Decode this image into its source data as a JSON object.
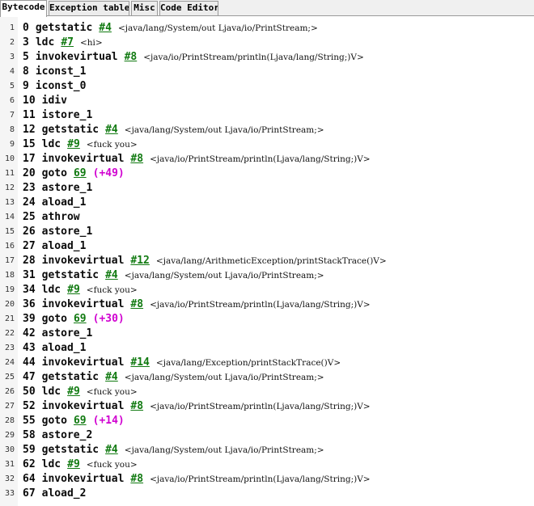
{
  "tabs": [
    {
      "label": "Bytecode",
      "active": true
    },
    {
      "label": "Exception table",
      "active": false
    },
    {
      "label": "Misc",
      "active": false
    },
    {
      "label": "Code Editor",
      "active": false
    }
  ],
  "lines": [
    {
      "n": "1",
      "off": "0",
      "op": "getstatic",
      "ref": "#4",
      "cmt": "<java/lang/System/out Ljava/io/PrintStream;>"
    },
    {
      "n": "2",
      "off": "3",
      "op": "ldc",
      "ref": "#7",
      "cmt": "<hi>"
    },
    {
      "n": "3",
      "off": "5",
      "op": "invokevirtual",
      "ref": "#8",
      "cmt": "<java/io/PrintStream/println(Ljava/lang/String;)V>"
    },
    {
      "n": "4",
      "off": "8",
      "op": "iconst_1"
    },
    {
      "n": "5",
      "off": "9",
      "op": "iconst_0"
    },
    {
      "n": "6",
      "off": "10",
      "op": "idiv"
    },
    {
      "n": "7",
      "off": "11",
      "op": "istore_1"
    },
    {
      "n": "8",
      "off": "12",
      "op": "getstatic",
      "ref": "#4",
      "cmt": "<java/lang/System/out Ljava/io/PrintStream;>"
    },
    {
      "n": "9",
      "off": "15",
      "op": "ldc",
      "ref": "#9",
      "cmt": "<fuck you>"
    },
    {
      "n": "10",
      "off": "17",
      "op": "invokevirtual",
      "ref": "#8",
      "cmt": "<java/io/PrintStream/println(Ljava/lang/String;)V>"
    },
    {
      "n": "11",
      "off": "20",
      "op": "goto",
      "ref": "69",
      "jump": "(+49)"
    },
    {
      "n": "12",
      "off": "23",
      "op": "astore_1"
    },
    {
      "n": "13",
      "off": "24",
      "op": "aload_1"
    },
    {
      "n": "14",
      "off": "25",
      "op": "athrow"
    },
    {
      "n": "15",
      "off": "26",
      "op": "astore_1"
    },
    {
      "n": "16",
      "off": "27",
      "op": "aload_1"
    },
    {
      "n": "17",
      "off": "28",
      "op": "invokevirtual",
      "ref": "#12",
      "cmt": "<java/lang/ArithmeticException/printStackTrace()V>"
    },
    {
      "n": "18",
      "off": "31",
      "op": "getstatic",
      "ref": "#4",
      "cmt": "<java/lang/System/out Ljava/io/PrintStream;>"
    },
    {
      "n": "19",
      "off": "34",
      "op": "ldc",
      "ref": "#9",
      "cmt": "<fuck you>"
    },
    {
      "n": "20",
      "off": "36",
      "op": "invokevirtual",
      "ref": "#8",
      "cmt": "<java/io/PrintStream/println(Ljava/lang/String;)V>"
    },
    {
      "n": "21",
      "off": "39",
      "op": "goto",
      "ref": "69",
      "jump": "(+30)"
    },
    {
      "n": "22",
      "off": "42",
      "op": "astore_1"
    },
    {
      "n": "23",
      "off": "43",
      "op": "aload_1"
    },
    {
      "n": "24",
      "off": "44",
      "op": "invokevirtual",
      "ref": "#14",
      "cmt": "<java/lang/Exception/printStackTrace()V>"
    },
    {
      "n": "25",
      "off": "47",
      "op": "getstatic",
      "ref": "#4",
      "cmt": "<java/lang/System/out Ljava/io/PrintStream;>"
    },
    {
      "n": "26",
      "off": "50",
      "op": "ldc",
      "ref": "#9",
      "cmt": "<fuck you>"
    },
    {
      "n": "27",
      "off": "52",
      "op": "invokevirtual",
      "ref": "#8",
      "cmt": "<java/io/PrintStream/println(Ljava/lang/String;)V>"
    },
    {
      "n": "28",
      "off": "55",
      "op": "goto",
      "ref": "69",
      "jump": "(+14)"
    },
    {
      "n": "29",
      "off": "58",
      "op": "astore_2"
    },
    {
      "n": "30",
      "off": "59",
      "op": "getstatic",
      "ref": "#4",
      "cmt": "<java/lang/System/out Ljava/io/PrintStream;>"
    },
    {
      "n": "31",
      "off": "62",
      "op": "ldc",
      "ref": "#9",
      "cmt": "<fuck you>"
    },
    {
      "n": "32",
      "off": "64",
      "op": "invokevirtual",
      "ref": "#8",
      "cmt": "<java/io/PrintStream/println(Ljava/lang/String;)V>"
    },
    {
      "n": "33",
      "off": "67",
      "op": "aload_2"
    }
  ],
  "colors": {
    "reference": "#117a11",
    "jump_offset": "#d000d0",
    "editor_background": "#ffffff"
  }
}
